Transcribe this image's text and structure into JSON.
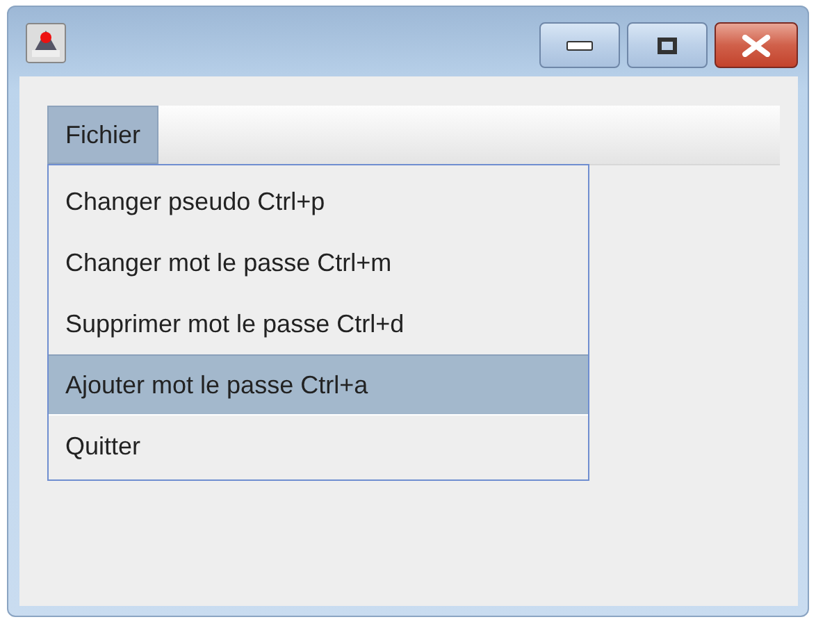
{
  "menu_bar": {
    "menus": [
      {
        "label": "Fichier",
        "selected": true
      }
    ]
  },
  "menu": {
    "items": [
      {
        "label": "Changer pseudo Ctrl+p",
        "selected": false
      },
      {
        "label": "Changer mot le passe Ctrl+m",
        "selected": false
      },
      {
        "label": "Supprimer mot le passe Ctrl+d",
        "selected": false
      },
      {
        "label": "Ajouter mot le passe Ctrl+a",
        "selected": true
      },
      {
        "label": "Quitter",
        "selected": false
      }
    ]
  }
}
